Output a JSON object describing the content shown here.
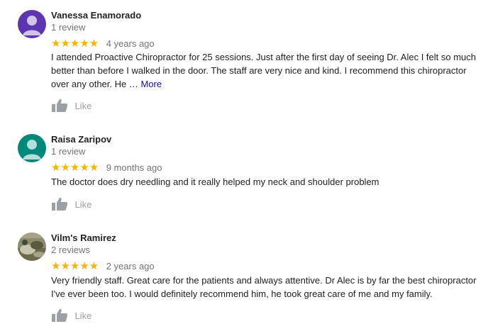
{
  "reviews": [
    {
      "name": "Vanessa Enamorado",
      "review_count": "1 review",
      "stars": "★★★★★",
      "rating": 5,
      "date": "4 years ago",
      "text": "I attended Proactive Chiropractor for 25 sessions. Just after the first day of seeing Dr. Alec I felt so much better than before I walked in the door. The staff are very nice and kind. I recommend this chiropractor over any other. He … ",
      "more_label": "More",
      "like_label": "Like",
      "avatar_icon": "person-icon",
      "avatar_color": "#5e35b1"
    },
    {
      "name": "Raisa Zaripov",
      "review_count": "1 review",
      "stars": "★★★★★",
      "rating": 5,
      "date": "9 months ago",
      "text": "The doctor does dry needling and it really helped my neck and shoulder problem",
      "like_label": "Like",
      "avatar_icon": "person-icon",
      "avatar_color": "#00897b"
    },
    {
      "name": "Vilm's Ramirez",
      "review_count": "2 reviews",
      "stars": "★★★★★",
      "rating": 5,
      "date": "2 years ago",
      "text": "Very friendly staff. Great care for the patients and always attentive. Dr Alec is by far the best chiropractor I've ever been too. I would definitely recommend him, he took great care of me and my family.",
      "like_label": "Like",
      "avatar_icon": "profile-photo"
    }
  ],
  "colors": {
    "star": "#f4b400",
    "link": "#1a0dab",
    "meta": "#70757a",
    "like": "#9aa0a6"
  }
}
